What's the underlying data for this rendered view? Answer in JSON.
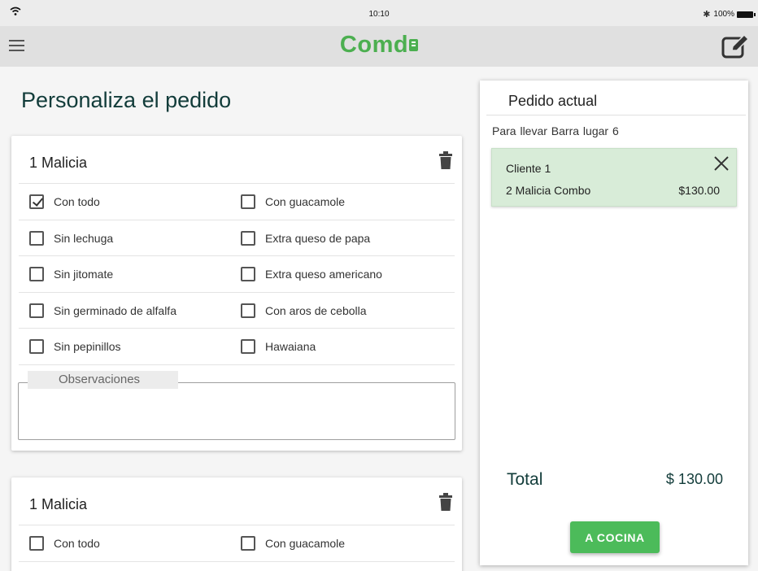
{
  "status_bar": {
    "time": "10:10",
    "battery": "100%"
  },
  "app": {
    "logo_text": "Comd"
  },
  "page": {
    "title": "Personaliza el pedido"
  },
  "products": [
    {
      "title": "1 Malicia",
      "options": [
        {
          "label": "Con todo",
          "checked": true
        },
        {
          "label": "Con guacamole",
          "checked": false
        },
        {
          "label": "Sin lechuga",
          "checked": false
        },
        {
          "label": "Extra queso de papa",
          "checked": false
        },
        {
          "label": "Sin jitomate",
          "checked": false
        },
        {
          "label": "Extra queso americano",
          "checked": false
        },
        {
          "label": "Sin germinado de alfalfa",
          "checked": false
        },
        {
          "label": "Con aros de cebolla",
          "checked": false
        },
        {
          "label": "Sin pepinillos",
          "checked": false
        },
        {
          "label": "Hawaiana",
          "checked": false
        }
      ],
      "observations_label": "Observaciones",
      "observations_value": ""
    },
    {
      "title": "1 Malicia",
      "options": [
        {
          "label": "Con todo",
          "checked": false
        },
        {
          "label": "Con guacamole",
          "checked": false
        }
      ]
    }
  ],
  "order": {
    "title": "Pedido actual",
    "subtitle": "Para llevar  Barra lugar 6",
    "client": {
      "name": "Cliente 1",
      "item": "2 Malicia Combo",
      "price": "$130.00"
    },
    "total_label": "Total",
    "total_value": "$ 130.00",
    "submit_label": "A COCINA"
  },
  "colors": {
    "brand": "#4caf50",
    "button": "#4cbb5a",
    "client_card": "#d8ecd8",
    "heading": "#123c3a"
  }
}
